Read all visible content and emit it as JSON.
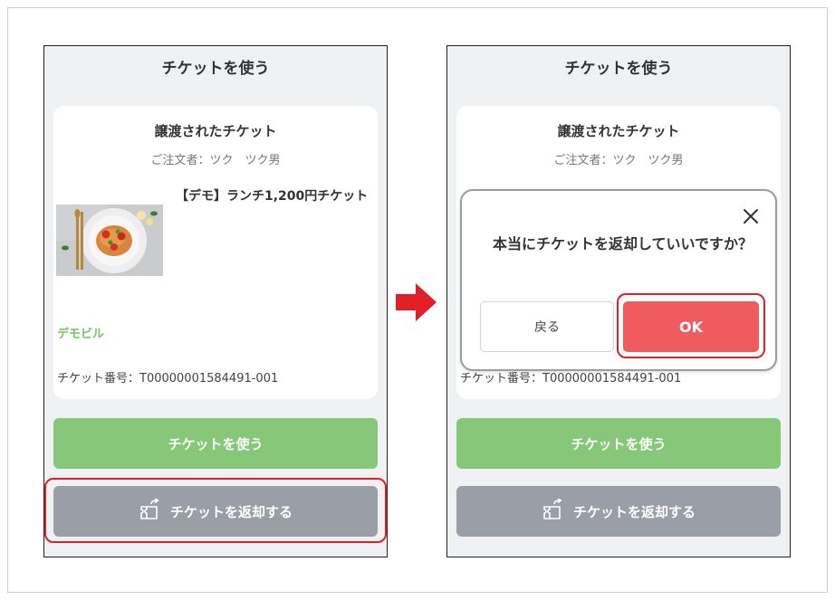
{
  "left_screen": {
    "header_title": "チケットを使う",
    "card": {
      "title": "譲渡されたチケット",
      "orderer": "ご注文者：ツク　ツク男",
      "product_name": "【デモ】ランチ1,200円チケット",
      "shop_name": "デモビル",
      "ticket_number": "チケット番号：T00000001584491-001"
    },
    "use_button": "チケットを使う",
    "return_button": "チケットを返却する"
  },
  "right_screen": {
    "header_title": "チケットを使う",
    "card": {
      "title": "譲渡されたチケット",
      "orderer": "ご注文者：ツク　ツク男",
      "ticket_number": "チケット番号：T00000001584491-001"
    },
    "dialog": {
      "message": "本当にチケットを返却していいですか？",
      "back_button": "戻る",
      "ok_button": "OK"
    },
    "use_button": "チケットを使う",
    "return_button": "チケットを返却する"
  },
  "colors": {
    "use_button": "#86c779",
    "return_button": "#9a9ea6",
    "ok_button": "#ef5b5e",
    "highlight": "#e01f26",
    "shop_name": "#76c461",
    "arrow": "#e01f26"
  },
  "icons": [
    "return-ticket-icon",
    "close-icon",
    "right-arrow-icon",
    "pasta-food-image"
  ]
}
